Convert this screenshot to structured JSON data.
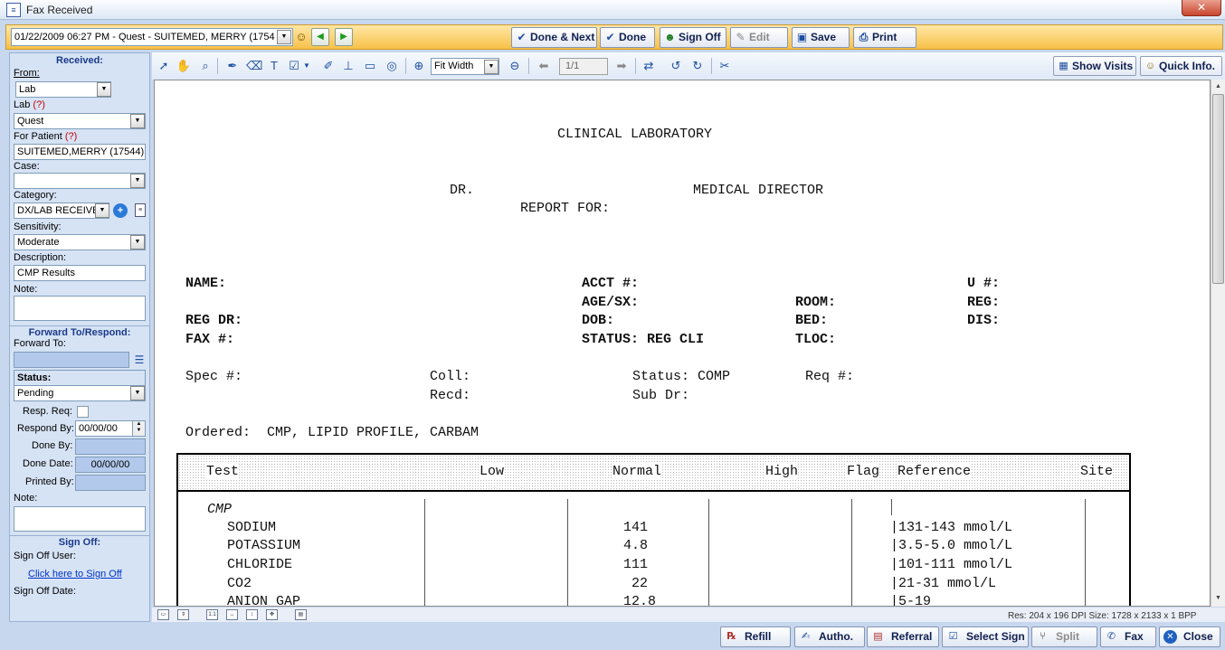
{
  "window": {
    "title": "Fax Received"
  },
  "header": {
    "record_selector": "01/22/2009   06:27 PM - Quest - SUITEMED, MERRY  (1754",
    "buttons": {
      "done_next": "Done & Next",
      "done": "Done",
      "sign_off": "Sign Off",
      "edit": "Edit",
      "save": "Save",
      "print": "Print"
    }
  },
  "left": {
    "received_header": "Received:",
    "from_label": "From:",
    "from_value": "Lab",
    "lab_label": "Lab",
    "help_mark": "(?)",
    "lab_value": "Quest",
    "patient_label": "For Patient",
    "patient_value": "SUITEMED,MERRY  (17544)",
    "case_label": "Case:",
    "case_value": "",
    "category_label": "Category:",
    "category_value": "DX/LAB RECEIVE",
    "sensitivity_label": "Sensitivity:",
    "sensitivity_value": "Moderate",
    "description_label": "Description:",
    "description_value": "CMP Results",
    "note_label": "Note:",
    "note_value": "",
    "forward_header": "Forward To/Respond:",
    "forward_label": "Forward To:",
    "forward_value": "",
    "status_label": "Status:",
    "status_value": "Pending",
    "resp_req_label": "Resp. Req:",
    "respond_by_label": "Respond By:",
    "respond_by_value": "00/00/00",
    "done_by_label": "Done By:",
    "done_by_value": "",
    "done_date_label": "Done Date:",
    "done_date_value": "00/00/00",
    "printed_by_label": "Printed By:",
    "printed_by_value": "",
    "note2_label": "Note:",
    "note2_value": "",
    "signoff_header": "Sign Off:",
    "signoff_user_label": "Sign Off User:",
    "signoff_link": "Click here to Sign Off",
    "signoff_date_label": "Sign Off Date:"
  },
  "toolbar": {
    "zoom": "Fit Width",
    "page": "1/1",
    "show_visits": "Show Visits",
    "quick_info": "Quick Info."
  },
  "fax": {
    "lab_title": "CLINICAL LABORATORY",
    "dr": "DR.",
    "medical_director": "MEDICAL DIRECTOR",
    "report_for": "REPORT FOR:",
    "name": "NAME:",
    "acct": "ACCT #:",
    "u": "U #:",
    "age_sx": "AGE/SX:",
    "room": "ROOM:",
    "reg": "REG:",
    "reg_dr": "REG DR:",
    "dob": "DOB:",
    "bed": "BED:",
    "dis": "DIS:",
    "fax": "FAX #:",
    "status": "STATUS: REG CLI",
    "tloc": "TLOC:",
    "spec": "Spec #:",
    "coll": "Coll:",
    "status2": "Status: COMP",
    "req": "Req #:",
    "recd": "Recd:",
    "sub_dr": "Sub Dr:",
    "ordered": "Ordered:  CMP, LIPID PROFILE, CARBAM",
    "table": {
      "headers": {
        "test": "Test",
        "low": "Low",
        "normal": "Normal",
        "high": "High",
        "flag": "Flag",
        "reference": "Reference",
        "site": "Site"
      },
      "group": "CMP",
      "rows": [
        {
          "test": "SODIUM",
          "normal": "141",
          "reference": "|131-143 mmol/L"
        },
        {
          "test": "POTASSIUM",
          "normal": "4.8",
          "reference": "|3.5-5.0 mmol/L"
        },
        {
          "test": "CHLORIDE",
          "normal": "111",
          "reference": "|101-111 mmol/L"
        },
        {
          "test": "CO2",
          "normal": "22",
          "reference": "|21-31 mmol/L"
        },
        {
          "test": "ANION GAP",
          "normal": "12.8",
          "reference": "|5-19"
        }
      ]
    }
  },
  "status_info": "Res:  204 x 196 DPI  Size: 1728 x 2133 x 1 BPP",
  "footer": {
    "refill": "Refill",
    "autho": "Autho.",
    "referral": "Referral",
    "select_sign": "Select Sign",
    "split": "Split",
    "fax": "Fax",
    "close": "Close"
  }
}
